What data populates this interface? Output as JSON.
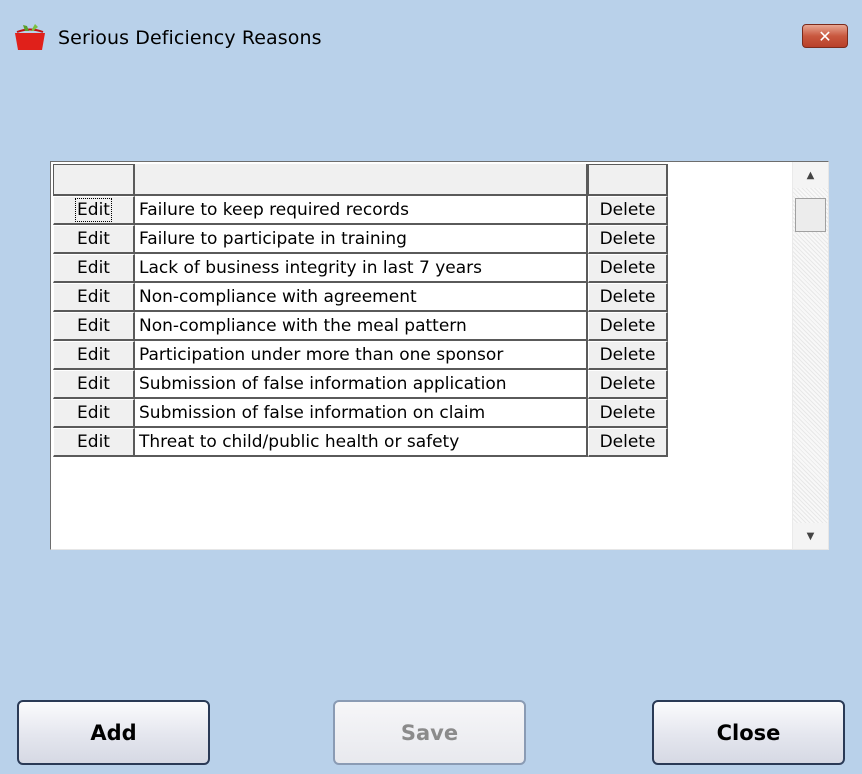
{
  "window": {
    "title": "Serious Deficiency Reasons",
    "close_glyph": "✕"
  },
  "grid": {
    "headers": [
      "",
      "",
      ""
    ],
    "edit_label": "Edit",
    "delete_label": "Delete",
    "rows": [
      "Failure to keep required records",
      "Failure to participate in training",
      "Lack of business integrity in last 7 years",
      "Non-compliance with agreement",
      "Non-compliance with the meal pattern",
      "Participation under more than one sponsor",
      "Submission of false information application",
      "Submission of false information on claim",
      "Threat to child/public health or safety"
    ]
  },
  "scrollbar": {
    "up_glyph": "▲",
    "down_glyph": "▼"
  },
  "buttons": {
    "add": "Add",
    "save": "Save",
    "close": "Close"
  },
  "colors": {
    "background": "#b9d1ea",
    "close_button": "#c9583f"
  }
}
